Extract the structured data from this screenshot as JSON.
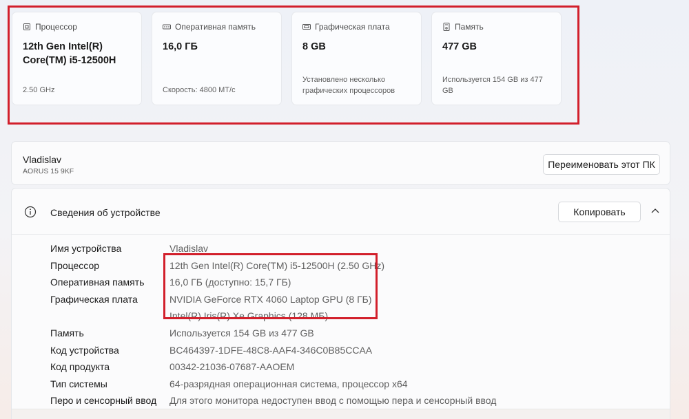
{
  "cards": [
    {
      "icon": "cpu-icon",
      "title": "Процессор",
      "value": "12th Gen Intel(R) Core(TM) i5-12500H",
      "sub": "2.50 GHz"
    },
    {
      "icon": "ram-icon",
      "title": "Оперативная память",
      "value": "16,0 ГБ",
      "sub": "Скорость: 4800 МТ/с"
    },
    {
      "icon": "gpu-icon",
      "title": "Графическая плата",
      "value": "8 GB",
      "sub": "Установлено несколько графических процессоров"
    },
    {
      "icon": "storage-icon",
      "title": "Память",
      "value": "477 GB",
      "sub": "Используется 154 GB из 477 GB"
    }
  ],
  "device": {
    "name": "Vladislav",
    "model": "AORUS 15 9KF",
    "rename_label": "Переименовать этот ПК"
  },
  "details": {
    "title": "Сведения об устройстве",
    "copy_label": "Копировать",
    "rows": [
      {
        "label": "Имя устройства",
        "value": "Vladislav"
      },
      {
        "label": "Процессор",
        "value": "12th Gen Intel(R) Core(TM) i5-12500H (2.50 GHz)"
      },
      {
        "label": "Оперативная память",
        "value": "16,0 ГБ (доступно: 15,7 ГБ)"
      },
      {
        "label": "Графическая плата",
        "value": "NVIDIA GeForce RTX 4060 Laptop GPU (8 ГБ)"
      },
      {
        "label": "",
        "value": "Intel(R) Iris(R) Xe Graphics (128 МБ)"
      },
      {
        "label": "Память",
        "value": "Используется 154 GB из 477 GB"
      },
      {
        "label": "Код устройства",
        "value": "BC464397-1DFE-48C8-AAF4-346C0B85CCAA"
      },
      {
        "label": "Код продукта",
        "value": "00342-21036-07687-AAOEM"
      },
      {
        "label": "Тип системы",
        "value": "64-разрядная операционная система, процессор x64"
      },
      {
        "label": "Перо и сенсорный ввод",
        "value": "Для этого монитора недоступен ввод с помощью пера и сенсорный ввод"
      }
    ]
  },
  "colors": {
    "highlight": "#d21f2b"
  }
}
